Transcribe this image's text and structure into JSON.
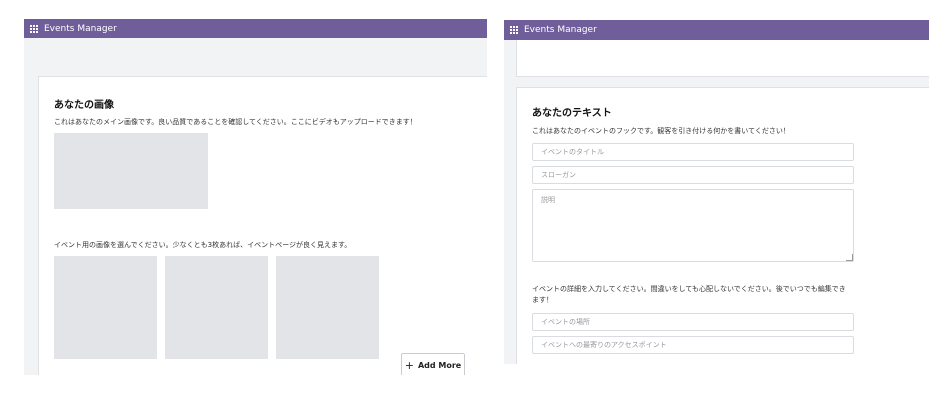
{
  "left_window": {
    "title": "Events Manager",
    "section_heading": "あなたの画像",
    "main_image_desc": "これはあなたのメイン画像です。良い品質であることを確認してください。ここにビデオもアップロードできます！",
    "gallery_desc": "イベント用の画像を選んでください。少なくとも3枚あれば、イベントページが良く見えます。",
    "add_more_label": "Add More"
  },
  "right_window": {
    "title": "Events Manager",
    "section_heading": "あなたのテキスト",
    "text_desc": "これはあなたのイベントのフックです。観客を引き付ける何かを書いてください！",
    "fields": {
      "title_placeholder": "イベントのタイトル",
      "slogan_placeholder": "スローガン",
      "description_placeholder": "説明"
    },
    "details_desc_line1": "イベントの詳細を入力してください。間違いをしても心配しないでください。後でいつでも編集でき",
    "details_desc_line2": "ます！",
    "detail_fields": {
      "location_placeholder": "イベントの場所",
      "access_placeholder": "イベントへの最寄りのアクセスポイント"
    }
  },
  "icons": {
    "app_menu": "grid-icon",
    "add": "plus-icon"
  },
  "colors": {
    "titlebar": "#6f5e9a",
    "placeholder_image": "#e2e4e8"
  }
}
